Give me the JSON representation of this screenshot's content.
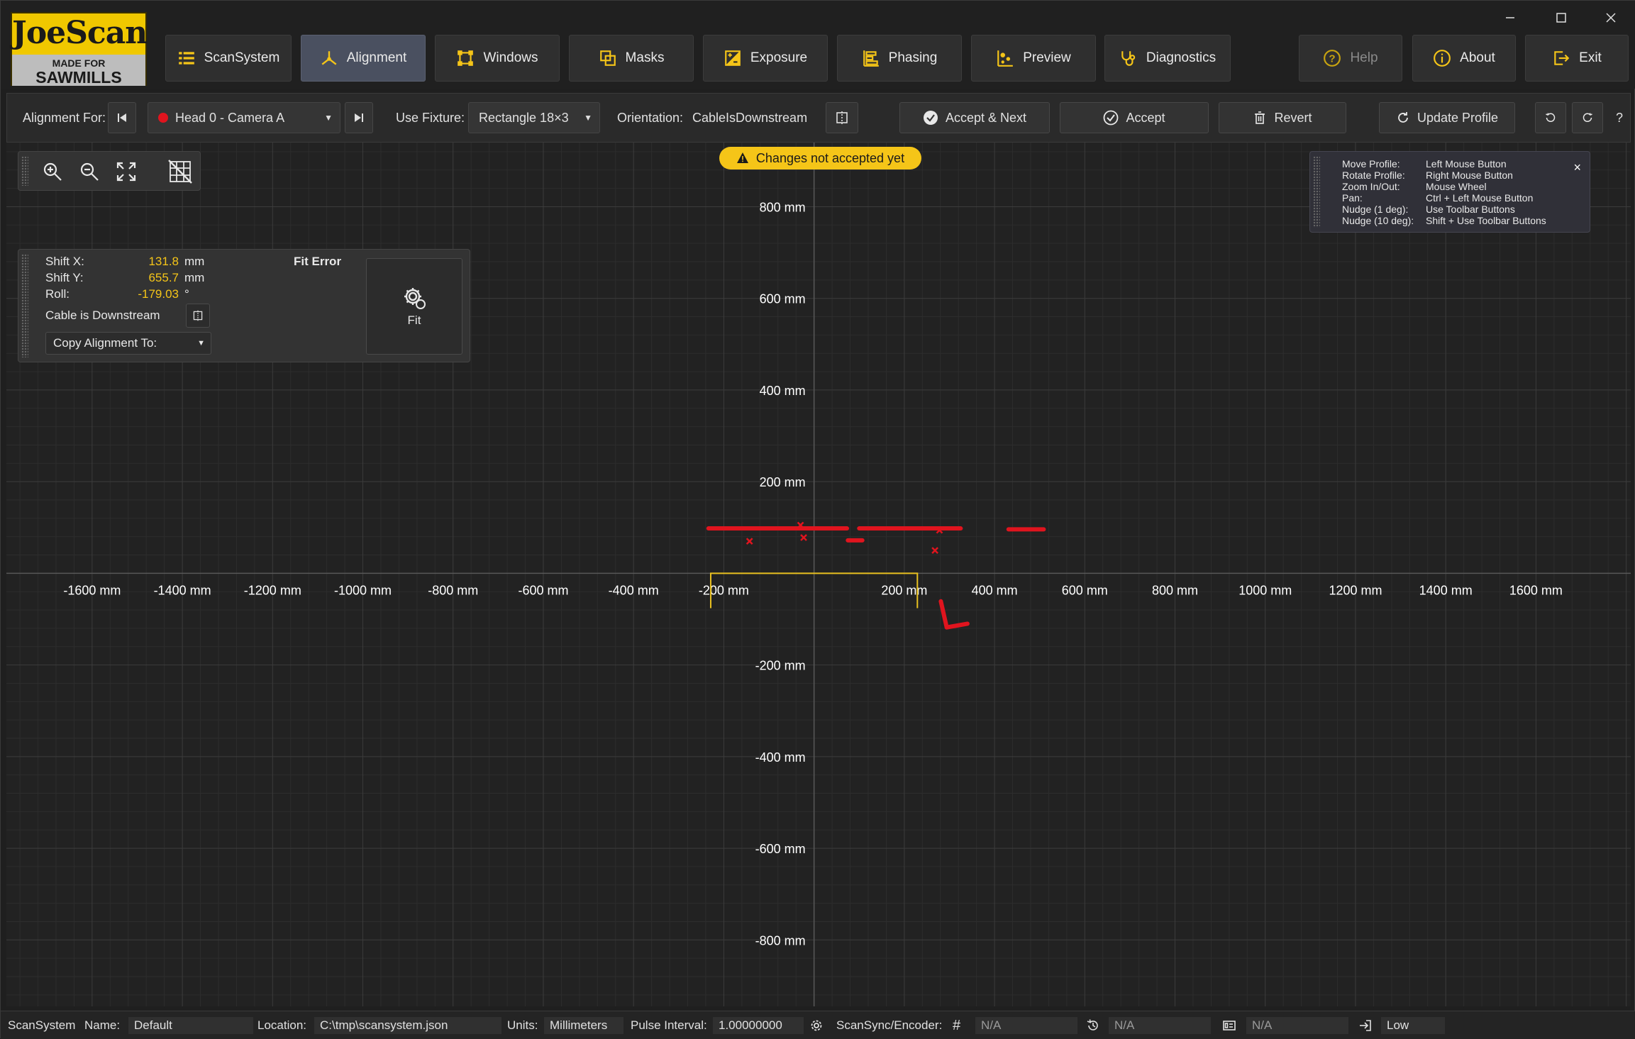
{
  "app": {
    "logo_text": "JoeScan",
    "logo_tag_top": "MADE FOR",
    "logo_tag_bottom": "SAWMILLS"
  },
  "nav": {
    "scansystem": "ScanSystem",
    "alignment": "Alignment",
    "windows": "Windows",
    "masks": "Masks",
    "exposure": "Exposure",
    "phasing": "Phasing",
    "preview": "Preview",
    "diagnostics": "Diagnostics",
    "help": "Help",
    "about": "About",
    "exit": "Exit"
  },
  "toolbar": {
    "alignment_for_label": "Alignment For:",
    "camera_selected": "Head 0 - Camera A",
    "use_fixture_label": "Use Fixture:",
    "fixture_selected": "Rectangle 18×3",
    "orientation_label": "Orientation:",
    "orientation_value": "CableIsDownstream",
    "accept_next": "Accept & Next",
    "accept": "Accept",
    "revert": "Revert",
    "update_profile": "Update Profile",
    "help_q": "?"
  },
  "warning": "Changes not accepted yet",
  "help_overlay": [
    {
      "action": "Move Profile:",
      "input": "Left Mouse Button"
    },
    {
      "action": "Rotate Profile:",
      "input": "Right Mouse Button"
    },
    {
      "action": "Zoom In/Out:",
      "input": "Mouse Wheel"
    },
    {
      "action": "Pan:",
      "input": "Ctrl + Left Mouse Button"
    },
    {
      "action": "Nudge (1 deg):",
      "input": "Use Toolbar Buttons"
    },
    {
      "action": "Nudge (10 deg):",
      "input": "Shift + Use Toolbar Buttons"
    }
  ],
  "help_close": "×",
  "align_panel": {
    "shift_x_label": "Shift X:",
    "shift_x_value": "131.8",
    "shift_x_unit": "mm",
    "shift_y_label": "Shift Y:",
    "shift_y_value": "655.7",
    "shift_y_unit": "mm",
    "roll_label": "Roll:",
    "roll_value": "-179.03",
    "roll_unit": "°",
    "fit_error_label": "Fit Error",
    "cable_label": "Cable is Downstream",
    "copy_label": "Copy Alignment To:",
    "fit_button": "Fit"
  },
  "chart_data": {
    "type": "scatter",
    "x_ticks": [
      "-1600 mm",
      "-1400 mm",
      "-1200 mm",
      "-1000 mm",
      "-800 mm",
      "-600 mm",
      "-400 mm",
      "-200 mm",
      "200 mm",
      "400 mm",
      "600 mm",
      "800 mm",
      "1000 mm",
      "1200 mm",
      "1400 mm",
      "1600 mm"
    ],
    "x_tick_values": [
      -1600,
      -1400,
      -1200,
      -1000,
      -800,
      -600,
      -400,
      -200,
      200,
      400,
      600,
      800,
      1000,
      1200,
      1400,
      1600
    ],
    "y_ticks": [
      "800 mm",
      "600 mm",
      "400 mm",
      "200 mm",
      "-200 mm",
      "-400 mm",
      "-600 mm",
      "-800 mm"
    ],
    "y_tick_values": [
      800,
      600,
      400,
      200,
      -200,
      -400,
      -600,
      -800
    ],
    "xlim": [
      -1790,
      1810
    ],
    "ylim": [
      -945,
      940
    ],
    "grid": true,
    "fixture_rect": {
      "x1": -229,
      "x2": 229,
      "y1": 0,
      "y2": -76
    },
    "profile_segments": [
      {
        "x1": -234,
        "y1": 98,
        "x2": 73,
        "y2": 98
      },
      {
        "x1": 100,
        "y1": 98,
        "x2": 325,
        "y2": 98
      },
      {
        "x1": 431,
        "y1": 96,
        "x2": 509,
        "y2": 96
      },
      {
        "x1": 75,
        "y1": 72,
        "x2": 107,
        "y2": 72
      },
      {
        "x1": 281,
        "y1": -61,
        "x2": 294,
        "y2": -118
      },
      {
        "x1": 294,
        "y1": -118,
        "x2": 340,
        "y2": -110
      }
    ],
    "profile_points": [
      {
        "x": -143,
        "y": 70
      },
      {
        "x": -23,
        "y": 78
      },
      {
        "x": -30,
        "y": 105
      },
      {
        "x": 268,
        "y": 50
      },
      {
        "x": 278,
        "y": 94
      }
    ]
  },
  "status": {
    "scansystem": "ScanSystem",
    "name_label": "Name:",
    "name_value": "Default",
    "location_label": "Location:",
    "location_value": "C:\\tmp\\scansystem.json",
    "units_label": "Units:",
    "units_value": "Millimeters",
    "pulse_label": "Pulse Interval:",
    "pulse_value": "1.00000000",
    "scansync_label": "ScanSync/Encoder:",
    "na1": "N/A",
    "na2": "N/A",
    "na3": "N/A",
    "level": "Low"
  },
  "colors": {
    "accent": "#f5c518",
    "profile": "#e0141e",
    "fixture": "#e8c020",
    "background": "#222222"
  }
}
